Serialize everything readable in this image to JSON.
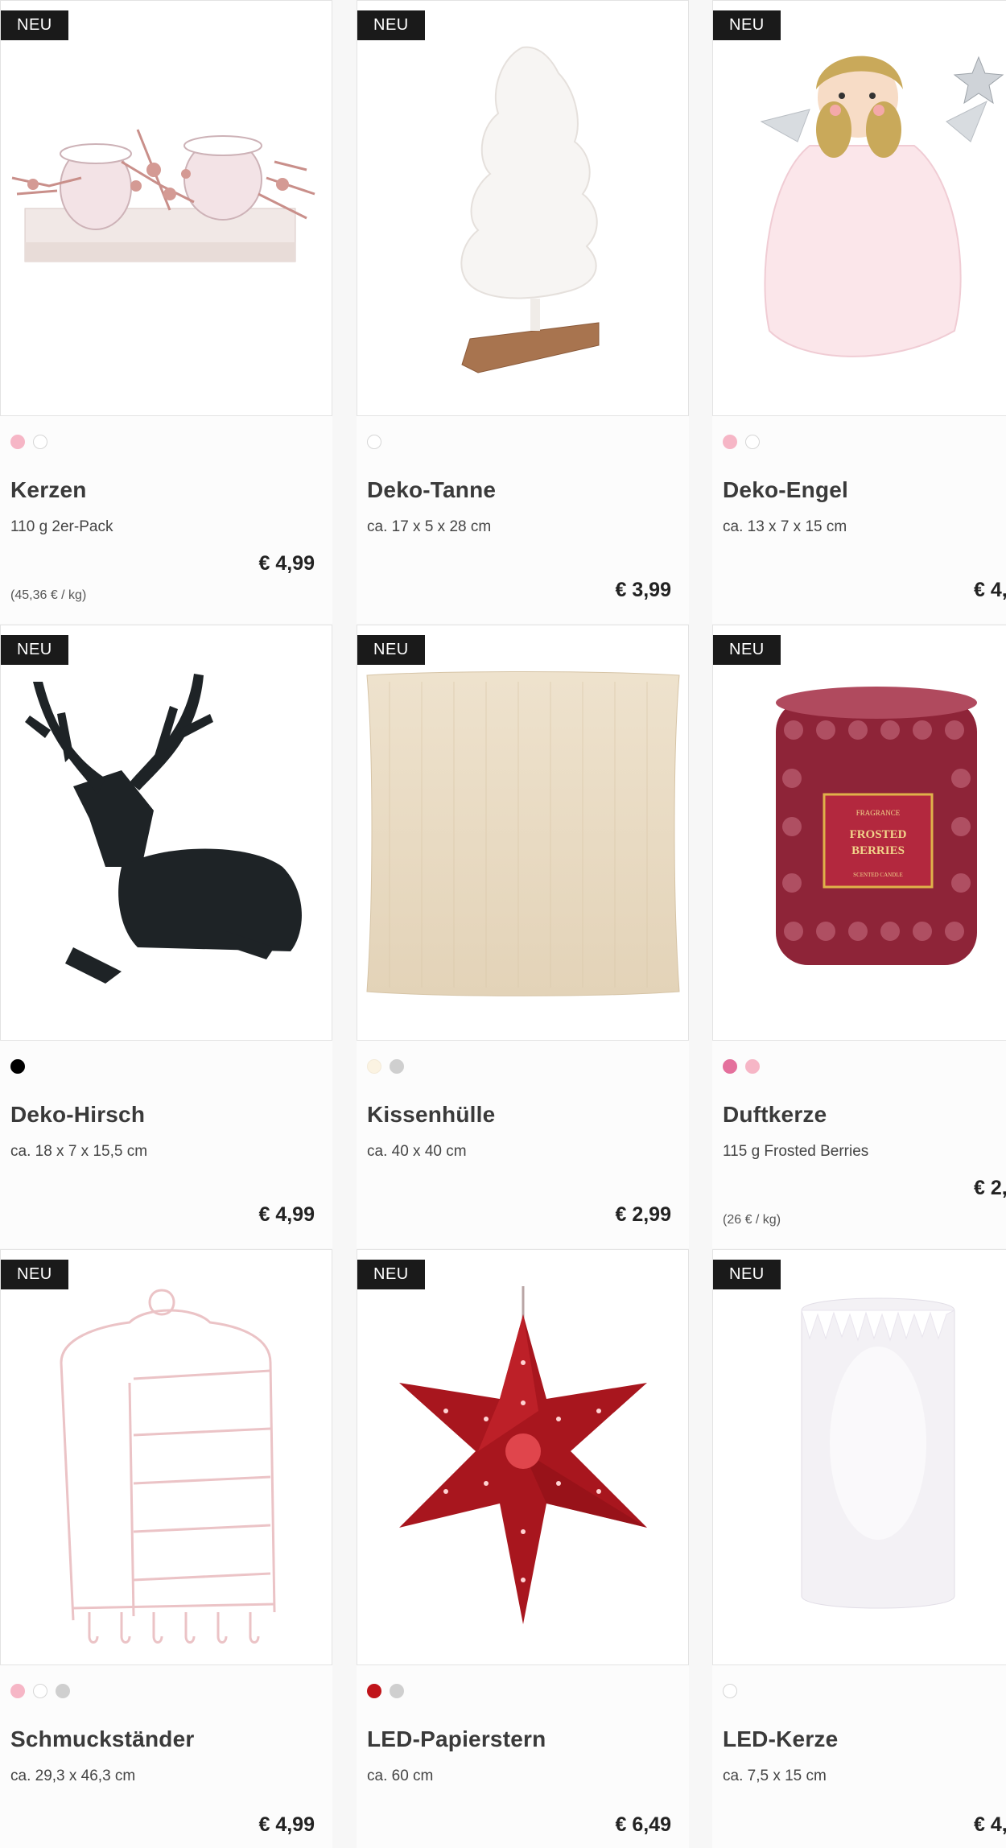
{
  "colors": {
    "badge_bg": "#1a1a1a",
    "badge_text": "#ffffff",
    "page_bg": "#f7f7f7"
  },
  "products": [
    {
      "badge": "NEU",
      "name": "Kerzen",
      "desc": "110 g 2er-Pack",
      "price": "€ 4,99",
      "unit_price": "(45,36 € / kg)",
      "swatches": [
        "#f6b6c6",
        "#ffffff"
      ],
      "image": "candle-holder-icon"
    },
    {
      "badge": "NEU",
      "name": "Deko-Tanne",
      "desc": "ca. 17 x 5 x 28 cm",
      "price": "€ 3,99",
      "unit_price": "",
      "swatches": [
        "#ffffff"
      ],
      "image": "fir-tree-icon"
    },
    {
      "badge": "NEU",
      "name": "Deko-Engel",
      "desc": "ca. 13 x 7 x 15 cm",
      "price": "€ 4,",
      "unit_price": "",
      "swatches": [
        "#f6b6c6",
        "#ffffff"
      ],
      "image": "angel-icon"
    },
    {
      "badge": "NEU",
      "name": "Deko-Hirsch",
      "desc": "ca. 18 x 7 x 15,5 cm",
      "price": "€ 4,99",
      "unit_price": "",
      "swatches": [
        "#000000"
      ],
      "image": "deer-icon"
    },
    {
      "badge": "NEU",
      "name": "Kissenhülle",
      "desc": "ca. 40 x 40 cm",
      "price": "€ 2,99",
      "unit_price": "",
      "swatches": [
        "#fbf3e2",
        "#cfcfcf"
      ],
      "image": "cushion-icon"
    },
    {
      "badge": "NEU",
      "name": "Duftkerze",
      "desc": "115 g Frosted Berries",
      "price": "€ 2,",
      "unit_price": "(26 € / kg)",
      "swatches": [
        "#e4709c",
        "#f6b6c6"
      ],
      "image": "scented-candle-icon",
      "label_small": "FRAGRANCE",
      "label_large": "FROSTED BERRIES",
      "label_bottom": "SCENTED CANDLE"
    },
    {
      "badge": "NEU",
      "name": "Schmuckständer",
      "desc": "ca. 29,3 x 46,3 cm",
      "price": "€ 4,99",
      "unit_price": "",
      "swatches": [
        "#f6b6c6",
        "#ffffff",
        "#cfcfcf"
      ],
      "image": "jewelry-stand-icon"
    },
    {
      "badge": "NEU",
      "name": "LED-Papierstern",
      "desc": "ca. 60 cm",
      "price": "€ 6,49",
      "unit_price": "",
      "swatches": [
        "#c0141a",
        "#cfcfcf"
      ],
      "image": "paper-star-icon"
    },
    {
      "badge": "NEU",
      "name": "LED-Kerze",
      "desc": "ca. 7,5 x 15 cm",
      "price": "€ 4,",
      "unit_price": "",
      "swatches": [
        "#ffffff"
      ],
      "image": "led-candle-icon"
    }
  ]
}
